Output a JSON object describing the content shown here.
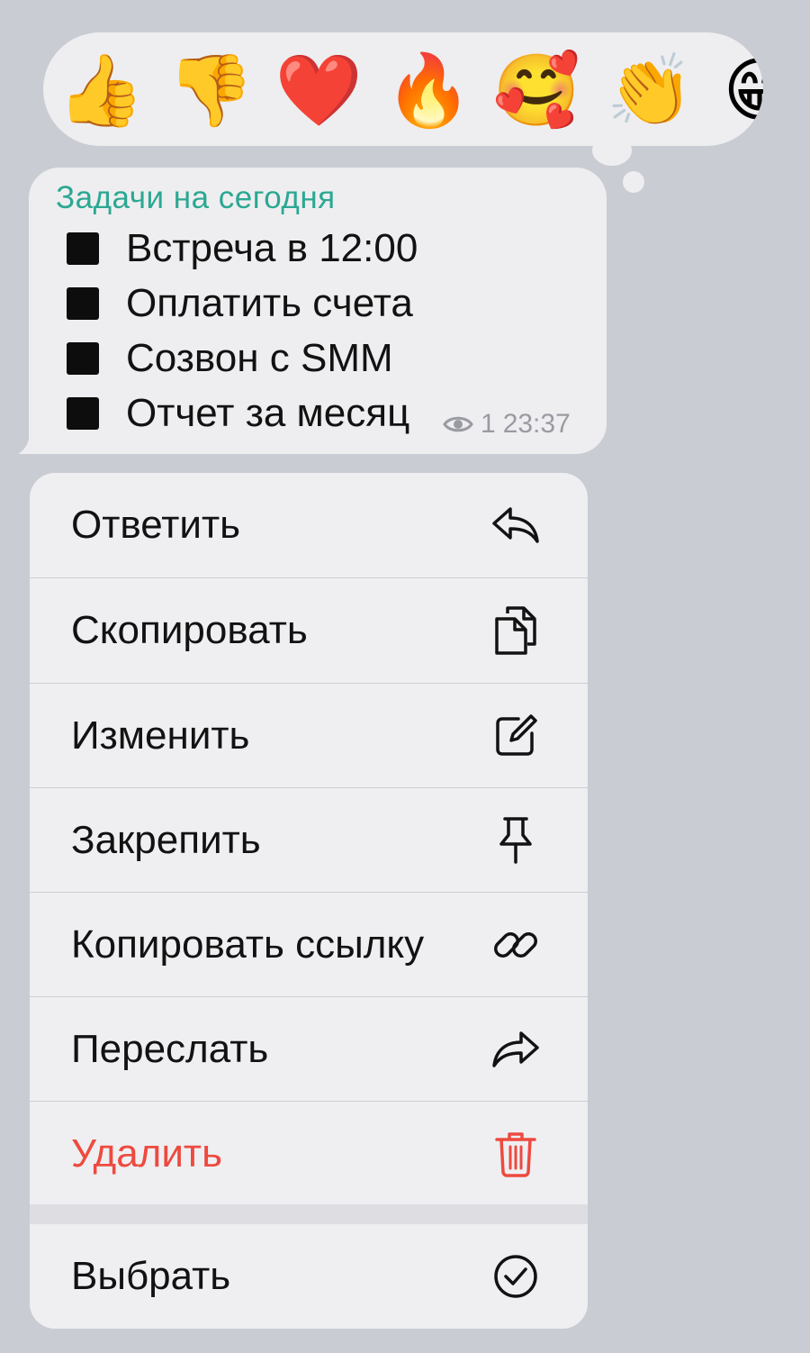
{
  "reactions": [
    {
      "name": "thumbs-up",
      "glyph": "👍"
    },
    {
      "name": "thumbs-down",
      "glyph": "👎"
    },
    {
      "name": "red-heart",
      "glyph": "❤️"
    },
    {
      "name": "fire",
      "glyph": "🔥"
    },
    {
      "name": "smiling-face-with-hearts",
      "glyph": "🥰"
    },
    {
      "name": "clapping-hands",
      "glyph": "👏"
    },
    {
      "name": "grinning-face",
      "glyph": "😁"
    }
  ],
  "message": {
    "title": "Задачи на сегодня",
    "tasks": [
      "Встреча в 12:00",
      "Оплатить счета",
      "Созвон с SMM",
      "Отчет за месяц"
    ],
    "views": "1",
    "time": "23:37"
  },
  "menu": {
    "items": [
      {
        "label": "Ответить",
        "icon": "reply-icon"
      },
      {
        "label": "Скопировать",
        "icon": "copy-icon"
      },
      {
        "label": "Изменить",
        "icon": "edit-icon"
      },
      {
        "label": "Закрепить",
        "icon": "pin-icon"
      },
      {
        "label": "Копировать ссылку",
        "icon": "link-icon"
      },
      {
        "label": "Переслать",
        "icon": "forward-icon"
      },
      {
        "label": "Удалить",
        "icon": "trash-icon"
      }
    ],
    "select": {
      "label": "Выбрать",
      "icon": "checkmark-circle-icon"
    }
  },
  "colors": {
    "accent_title": "#2ba892",
    "danger": "#ee4a3f",
    "background": "#c9ccd3"
  }
}
